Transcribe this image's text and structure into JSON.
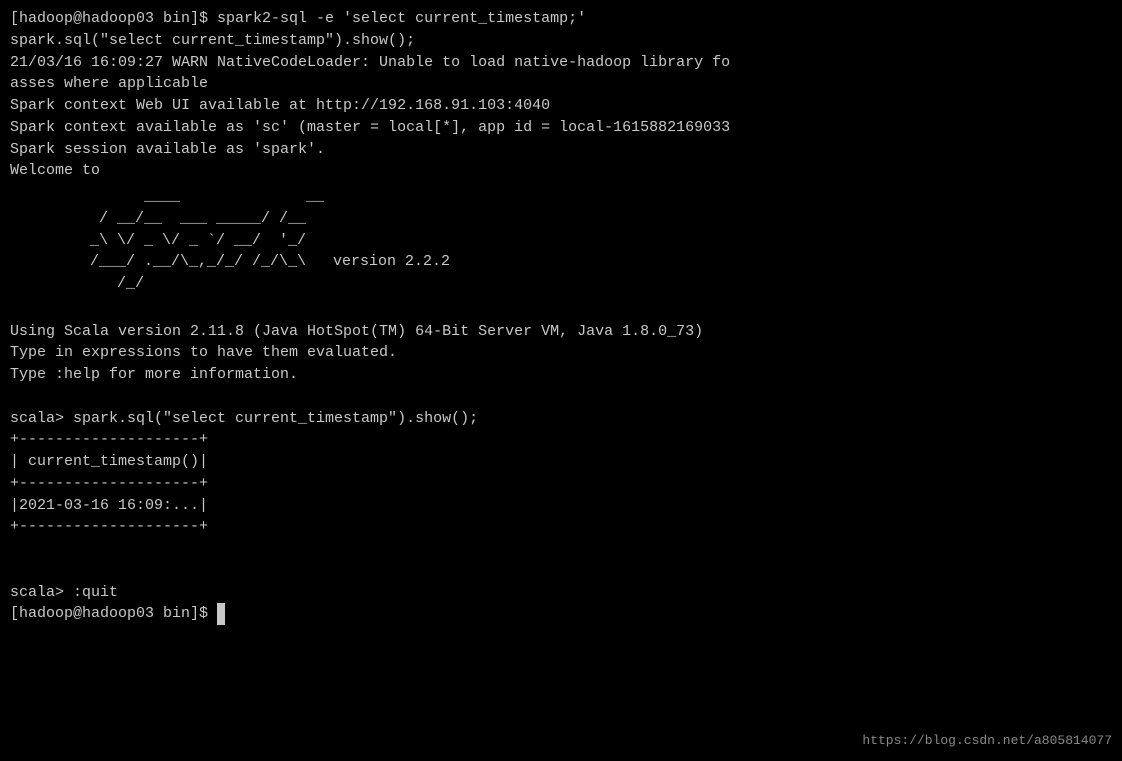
{
  "terminal": {
    "lines": [
      {
        "id": "cmd",
        "text": "[hadoop@hadoop03 bin]$ spark2-sql -e 'select current_timestamp;'"
      },
      {
        "id": "show",
        "text": "spark.sql(\"select current_timestamp\").show();"
      },
      {
        "id": "warn",
        "text": "21/03/16 16:09:27 WARN NativeCodeLoader: Unable to load native-hadoop library fo"
      },
      {
        "id": "asses",
        "text": "asses where applicable"
      },
      {
        "id": "webui",
        "text": "Spark context Web UI available at http://192.168.91.103:4040"
      },
      {
        "id": "sc",
        "text": "Spark context available as 'sc' (master = local[*], app id = local-1615882169033"
      },
      {
        "id": "session",
        "text": "Spark session available as 'spark'."
      },
      {
        "id": "welcome",
        "text": "Welcome to"
      }
    ],
    "ascii_art": [
      "      ____              __",
      " / __/__  ___ _____/ /__",
      "_\\ \\/ _ \\/ _ `/ __/  '_/",
      "/___/ .__/\\_,_/_/ /_/\\_\\   version 2.2.2",
      "   /_/"
    ],
    "after_ascii": [
      "",
      "Using Scala version 2.11.8 (Java HotSpot(TM) 64-Bit Server VM, Java 1.8.0_73)",
      "Type in expressions to have them evaluated.",
      "Type :help for more information.",
      "",
      "scala> spark.sql(\"select current_timestamp\").show();",
      "+--------------------+",
      "| current_timestamp()|",
      "+--------------------+",
      "|2021-03-16 16:09:...|",
      "+--------------------+",
      "",
      "",
      "scala> :quit",
      "[hadoop@hadoop03 bin]$ "
    ],
    "watermark": "https://blog.csdn.net/a805814077"
  }
}
